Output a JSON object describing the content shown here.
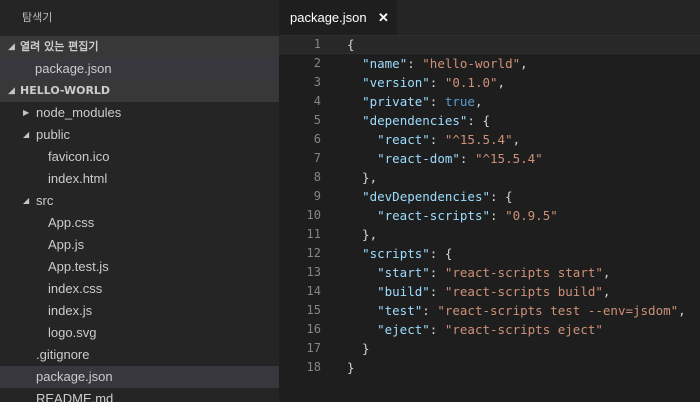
{
  "sidebar": {
    "title": "탐색기",
    "open_editors": {
      "label": "열려 있는 편집기",
      "items": [
        "package.json"
      ]
    },
    "folder": {
      "label": "HELLO-WORLD",
      "items": [
        {
          "label": "node_modules",
          "depth": 0,
          "twisty": "collapsed",
          "selected": false
        },
        {
          "label": "public",
          "depth": 0,
          "twisty": "expanded",
          "selected": false
        },
        {
          "label": "favicon.ico",
          "depth": 1,
          "twisty": "none",
          "selected": false
        },
        {
          "label": "index.html",
          "depth": 1,
          "twisty": "none",
          "selected": false
        },
        {
          "label": "src",
          "depth": 0,
          "twisty": "expanded",
          "selected": false
        },
        {
          "label": "App.css",
          "depth": 1,
          "twisty": "none",
          "selected": false
        },
        {
          "label": "App.js",
          "depth": 1,
          "twisty": "none",
          "selected": false
        },
        {
          "label": "App.test.js",
          "depth": 1,
          "twisty": "none",
          "selected": false
        },
        {
          "label": "index.css",
          "depth": 1,
          "twisty": "none",
          "selected": false
        },
        {
          "label": "index.js",
          "depth": 1,
          "twisty": "none",
          "selected": false
        },
        {
          "label": "logo.svg",
          "depth": 1,
          "twisty": "none",
          "selected": false
        },
        {
          "label": ".gitignore",
          "depth": 0,
          "twisty": "none",
          "selected": false
        },
        {
          "label": "package.json",
          "depth": 0,
          "twisty": "none",
          "selected": true
        },
        {
          "label": "README.md",
          "depth": 0,
          "twisty": "none",
          "selected": false
        }
      ]
    }
  },
  "tab": {
    "label": "package.json",
    "close": "✕"
  },
  "icons": {
    "expanded": "◢",
    "collapsed": "▶"
  },
  "colors": {
    "key": "#9cdcfe",
    "string": "#ce9178",
    "boolean": "#569cd6",
    "punct": "#d4d4d4",
    "line_number": "#858585"
  },
  "editor": {
    "lines": [
      [
        {
          "t": "p",
          "v": "{"
        }
      ],
      [
        {
          "t": "p",
          "v": "  "
        },
        {
          "t": "k",
          "v": "\"name\""
        },
        {
          "t": "p",
          "v": ": "
        },
        {
          "t": "s",
          "v": "\"hello-world\""
        },
        {
          "t": "p",
          "v": ","
        }
      ],
      [
        {
          "t": "p",
          "v": "  "
        },
        {
          "t": "k",
          "v": "\"version\""
        },
        {
          "t": "p",
          "v": ": "
        },
        {
          "t": "s",
          "v": "\"0.1.0\""
        },
        {
          "t": "p",
          "v": ","
        }
      ],
      [
        {
          "t": "p",
          "v": "  "
        },
        {
          "t": "k",
          "v": "\"private\""
        },
        {
          "t": "p",
          "v": ": "
        },
        {
          "t": "b",
          "v": "true"
        },
        {
          "t": "p",
          "v": ","
        }
      ],
      [
        {
          "t": "p",
          "v": "  "
        },
        {
          "t": "k",
          "v": "\"dependencies\""
        },
        {
          "t": "p",
          "v": ": {"
        }
      ],
      [
        {
          "t": "p",
          "v": "    "
        },
        {
          "t": "k",
          "v": "\"react\""
        },
        {
          "t": "p",
          "v": ": "
        },
        {
          "t": "s",
          "v": "\"^15.5.4\""
        },
        {
          "t": "p",
          "v": ","
        }
      ],
      [
        {
          "t": "p",
          "v": "    "
        },
        {
          "t": "k",
          "v": "\"react-dom\""
        },
        {
          "t": "p",
          "v": ": "
        },
        {
          "t": "s",
          "v": "\"^15.5.4\""
        }
      ],
      [
        {
          "t": "p",
          "v": "  },"
        }
      ],
      [
        {
          "t": "p",
          "v": "  "
        },
        {
          "t": "k",
          "v": "\"devDependencies\""
        },
        {
          "t": "p",
          "v": ": {"
        }
      ],
      [
        {
          "t": "p",
          "v": "    "
        },
        {
          "t": "k",
          "v": "\"react-scripts\""
        },
        {
          "t": "p",
          "v": ": "
        },
        {
          "t": "s",
          "v": "\"0.9.5\""
        }
      ],
      [
        {
          "t": "p",
          "v": "  },"
        }
      ],
      [
        {
          "t": "p",
          "v": "  "
        },
        {
          "t": "k",
          "v": "\"scripts\""
        },
        {
          "t": "p",
          "v": ": {"
        }
      ],
      [
        {
          "t": "p",
          "v": "    "
        },
        {
          "t": "k",
          "v": "\"start\""
        },
        {
          "t": "p",
          "v": ": "
        },
        {
          "t": "s",
          "v": "\"react-scripts start\""
        },
        {
          "t": "p",
          "v": ","
        }
      ],
      [
        {
          "t": "p",
          "v": "    "
        },
        {
          "t": "k",
          "v": "\"build\""
        },
        {
          "t": "p",
          "v": ": "
        },
        {
          "t": "s",
          "v": "\"react-scripts build\""
        },
        {
          "t": "p",
          "v": ","
        }
      ],
      [
        {
          "t": "p",
          "v": "    "
        },
        {
          "t": "k",
          "v": "\"test\""
        },
        {
          "t": "p",
          "v": ": "
        },
        {
          "t": "s",
          "v": "\"react-scripts test --env=jsdom\""
        },
        {
          "t": "p",
          "v": ","
        }
      ],
      [
        {
          "t": "p",
          "v": "    "
        },
        {
          "t": "k",
          "v": "\"eject\""
        },
        {
          "t": "p",
          "v": ": "
        },
        {
          "t": "s",
          "v": "\"react-scripts eject\""
        }
      ],
      [
        {
          "t": "p",
          "v": "  }"
        }
      ],
      [
        {
          "t": "p",
          "v": "}"
        }
      ]
    ]
  }
}
